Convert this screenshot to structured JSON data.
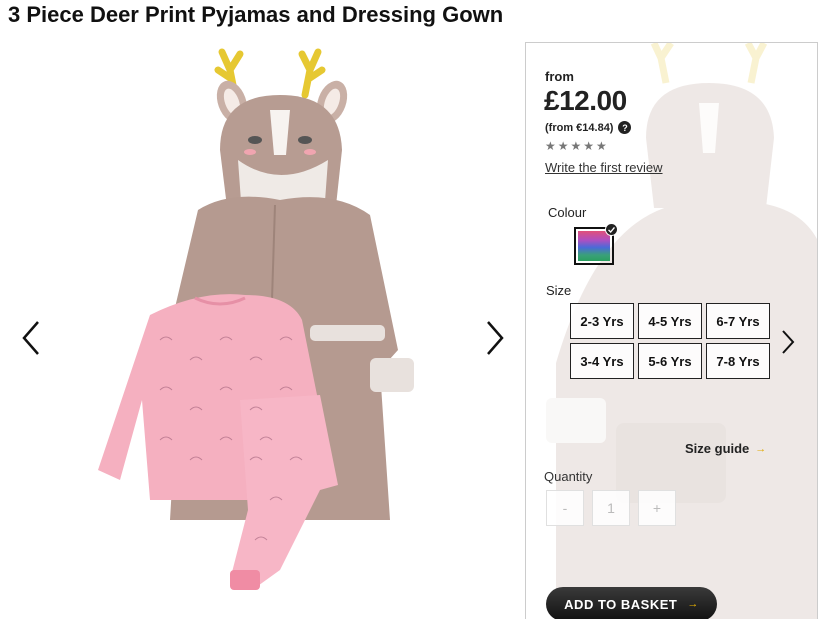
{
  "product": {
    "title": "3 Piece Deer Print Pyjamas and Dressing Gown"
  },
  "gallery": {
    "prev_icon": "chevron-left-icon",
    "next_icon": "chevron-right-icon",
    "image_alt": "deer-dressing-gown-and-pyjamas"
  },
  "pricing": {
    "from_label": "from",
    "price": "£12.00",
    "euro_price": "(from €14.84)",
    "help_symbol": "?",
    "rating_stars": "★★★★★",
    "review_link": "Write the first review"
  },
  "colour": {
    "label": "Colour",
    "swatch_icon": "multicolour-swatch",
    "check_icon": "check-icon"
  },
  "size": {
    "label": "Size",
    "options": [
      "2-3 Yrs",
      "4-5 Yrs",
      "6-7 Yrs",
      "3-4 Yrs",
      "5-6 Yrs",
      "7-8 Yrs"
    ],
    "guide_label": "Size guide",
    "guide_arrow": "→"
  },
  "quantity": {
    "label": "Quantity",
    "minus": "-",
    "value": "1",
    "plus": "+"
  },
  "basket": {
    "label": "ADD TO BASKET",
    "arrow": "→"
  },
  "colors": {
    "accent": "#e0a800",
    "button_bg": "#111111",
    "gown": "#b59a90",
    "pyjama": "#f5b0c0"
  }
}
